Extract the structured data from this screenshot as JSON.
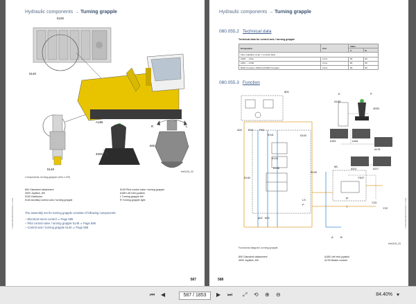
{
  "left_page": {
    "header_section": "Hydraulic components",
    "header_title": "Turning grapple",
    "labels": {
      "l5140": "5140",
      "l5100": "5100",
      "la185": "A185",
      "l4000": "4000",
      "l800": "800",
      "l5149": "5149",
      "lr": "R",
      "ll": "L"
    },
    "figure_id": "fhb0126_00",
    "figure_caption": "Components, turning grapple (A9x-x-VR)",
    "legend_left": [
      "800 Clamshell attachment",
      "4000 Joystick, left",
      "5100 Distributor",
      "5140 Auxiliary control axis / turning grapple"
    ],
    "legend_right": [
      "5149 Pilot control valve / turning grapple",
      "A185 Left mini-joystick",
      "L Turning grapple left",
      "R Turning grapple right"
    ],
    "assembly_text": "The assembly set for turning grapple consists of following components:",
    "bullets": [
      "Electrical servo control ⇒ Page 599",
      "Pilot control valve / turning grapple 5149 ⇒ Page 589",
      "Control axis / turning grapple 5140 ⇒ Page 588"
    ],
    "side_text": "LHB/2386/9006/0001/EN-2.3 Mar",
    "page_number": "587"
  },
  "right_page": {
    "header_section": "Hydraulic components",
    "header_title": "Turning grapple",
    "section1_num": "080.055.2",
    "section1_title": "Technical data",
    "table_caption": "Technical data for control axis / turning grapple",
    "table_headers": [
      "Designation",
      "Unit",
      "Value"
    ],
    "table_subheaders": [
      "A",
      "B"
    ],
    "table_rows": [
      [
        "Flow regulation at Δp = nominal value",
        "",
        "",
        ""
      ],
      [
        "A918 → LI/Se",
        "L/min",
        "80",
        "80"
      ],
      [
        "A934 → LI/SR",
        "L/min",
        "80",
        "80"
      ],
      [
        "R924 Compact, R918 and R920 Compact",
        "L/min",
        "80",
        "80"
      ]
    ],
    "section2_num": "080.055.3",
    "section2_title": "Function",
    "diagram_labels": {
      "d800": "800",
      "de": "E",
      "dp": "P",
      "da185": "A185",
      "d4000": "4000",
      "da02": "A02",
      "db02": "B02",
      "dp02": "P02",
      "d5141": "5141",
      "d5143": "5143",
      "d5146": "5146",
      "d5100": "5100",
      "d5140": "5140",
      "dls": "LS",
      "dp2": "P",
      "da02b": "a02",
      "db02b": "b02",
      "d5149": "5149",
      "dml": "ML",
      "dy547": "Y547",
      "dy23": "Y23",
      "dy22": "Y22",
      "dpr": "pr",
      "dt": "T",
      "da": "A",
      "db": "B",
      "da183": "A183",
      "da184": "A184",
      "da178": "A178",
      "da201": "A201",
      "da217": "A217"
    },
    "figure_id": "fhb0126_03",
    "figure_caption": "Functional diagram, turning grapple",
    "legend_left": [
      "800 Clamshell attachment",
      "4000 Joystick, left"
    ],
    "legend_right": [
      "A185 Left mini-joystick",
      "A178 Master module"
    ],
    "side_text": "LHB/2386/9006/0001/EN-2.3 Mar",
    "page_number": "588"
  },
  "toolbar": {
    "page_input": "587 / 1853",
    "zoom": "84.40%"
  },
  "colors": {
    "header_blue": "#3b5a8a",
    "machine_yellow": "#e8c400",
    "joystick_green": "#4caf50",
    "hydraulic_orange": "#e0a030",
    "hydraulic_blue": "#3a8fd8"
  }
}
